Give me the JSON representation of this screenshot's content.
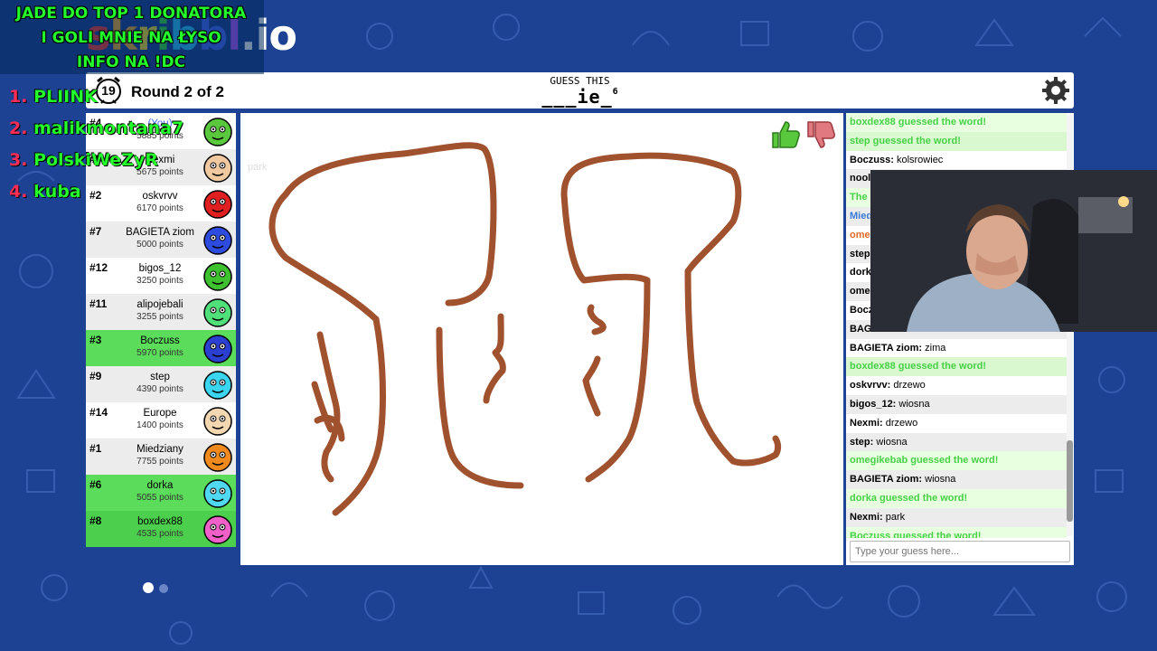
{
  "overlay": {
    "lines": [
      "JADE DO TOP 1 DONATORA",
      "I GOLI MNIE NA ŁYSO",
      "INFO NA !DC"
    ],
    "logo": "skribbl.io",
    "leaderboard": [
      {
        "num": "1.",
        "name": "PLIINK"
      },
      {
        "num": "2.",
        "name": "malikmontana7"
      },
      {
        "num": "3.",
        "name": "PolskiWeZyR"
      },
      {
        "num": "4.",
        "name": "kuba"
      }
    ]
  },
  "header": {
    "timer": "19",
    "round": "Round 2 of 2",
    "guess_label": "GUESS THIS",
    "hint": "___ie_",
    "hint_len": "6"
  },
  "players": [
    {
      "rank": "#4",
      "name": "",
      "you": "(You)",
      "points": "5885 points",
      "avatar_color": "#5ac83c",
      "guessed": false
    },
    {
      "rank": "#5",
      "name": "Nexmi",
      "you": "",
      "points": "5675 points",
      "avatar_color": "#f0c9a0",
      "guessed": false
    },
    {
      "rank": "#2",
      "name": "oskvrvv",
      "you": "",
      "points": "6170 points",
      "avatar_color": "#e02020",
      "guessed": false
    },
    {
      "rank": "#7",
      "name": "BAGIETA ziom",
      "you": "",
      "points": "5000 points",
      "avatar_color": "#2e4be0",
      "guessed": false
    },
    {
      "rank": "#12",
      "name": "bigos_12",
      "you": "",
      "points": "3250 points",
      "avatar_color": "#3ec12e",
      "guessed": false
    },
    {
      "rank": "#11",
      "name": "alipojebali",
      "you": "",
      "points": "3255 points",
      "avatar_color": "#4fe07a",
      "guessed": false
    },
    {
      "rank": "#3",
      "name": "Boczuss",
      "you": "",
      "points": "5970 points",
      "avatar_color": "#2b3fd0",
      "guessed": true
    },
    {
      "rank": "#9",
      "name": "step",
      "you": "",
      "points": "4390 points",
      "avatar_color": "#3ad6f0",
      "guessed": false
    },
    {
      "rank": "#14",
      "name": "Europe",
      "you": "",
      "points": "1400 points",
      "avatar_color": "#f3d7b0",
      "guessed": false
    },
    {
      "rank": "#1",
      "name": "Miedziany",
      "you": "",
      "points": "7755 points",
      "avatar_color": "#f08a1e",
      "guessed": false
    },
    {
      "rank": "#6",
      "name": "dorka",
      "you": "",
      "points": "5055 points",
      "avatar_color": "#4fd8f0",
      "guessed": true
    },
    {
      "rank": "#8",
      "name": "boxdex88",
      "you": "",
      "points": "4535 points",
      "avatar_color": "#f060c8",
      "guessed": true
    }
  ],
  "canvas": {
    "ghost_word": "park",
    "stroke_color": "#a0512d",
    "thumbs_up_color": "#5ac83c",
    "thumbs_down_color": "#e07a80"
  },
  "chat": {
    "messages": [
      {
        "user": "",
        "text": "boxdex88 guessed the word!",
        "type": "green"
      },
      {
        "user": "",
        "text": "step guessed the word!",
        "type": "green"
      },
      {
        "user": "Boczuss:",
        "text": " kolsrowiec",
        "type": "normal"
      },
      {
        "user": "nool",
        "text": "",
        "type": "normal"
      },
      {
        "user": "",
        "text": "The",
        "type": "green"
      },
      {
        "user": "Mied",
        "text": "",
        "type": "blue"
      },
      {
        "user": "ome",
        "text": "",
        "type": "orange"
      },
      {
        "user": "step",
        "text": "",
        "type": "normal"
      },
      {
        "user": "dork",
        "text": "",
        "type": "normal"
      },
      {
        "user": "ome",
        "text": "",
        "type": "normal"
      },
      {
        "user": "Bocz",
        "text": "",
        "type": "normal"
      },
      {
        "user": "BAG",
        "text": "",
        "type": "normal"
      },
      {
        "user": "BAGIETA ziom:",
        "text": " zima",
        "type": "normal"
      },
      {
        "user": "",
        "text": "boxdex88 guessed the word!",
        "type": "green"
      },
      {
        "user": "oskvrvv:",
        "text": " drzewo",
        "type": "normal"
      },
      {
        "user": "bigos_12:",
        "text": " wiosna",
        "type": "normal"
      },
      {
        "user": "Nexmi:",
        "text": " drzewo",
        "type": "normal"
      },
      {
        "user": "step:",
        "text": " wiosna",
        "type": "normal"
      },
      {
        "user": "",
        "text": "omegikebab guessed the word!",
        "type": "green"
      },
      {
        "user": "BAGIETA ziom:",
        "text": " wiosna",
        "type": "normal"
      },
      {
        "user": "",
        "text": "dorka guessed the word!",
        "type": "green"
      },
      {
        "user": "Nexmi:",
        "text": " park",
        "type": "normal"
      },
      {
        "user": "",
        "text": "Boczuss guessed the word!",
        "type": "green"
      }
    ],
    "input_placeholder": "Type your guess here..."
  },
  "colors": {
    "background": "#1d4293",
    "guessed_bg": "#5bdc5b",
    "overlay_green": "#22ff2a",
    "overlay_red": "#ff2d55"
  },
  "icons": {
    "timer": "alarm-clock-icon",
    "settings": "gear-icon",
    "like": "thumbs-up-icon",
    "dislike": "thumbs-down-icon"
  }
}
